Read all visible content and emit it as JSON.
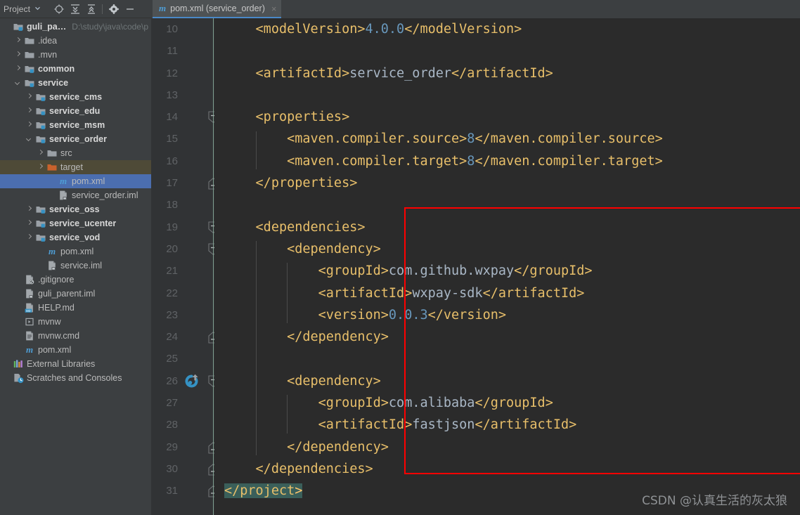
{
  "sidebar": {
    "toolbar": {
      "title": "Project",
      "caret": "▾",
      "icons": [
        {
          "name": "locate-icon",
          "glyph": "⊕"
        },
        {
          "name": "expand-all-icon",
          "glyph": "⤒"
        },
        {
          "name": "collapse-all-icon",
          "glyph": "⤓"
        },
        {
          "name": "settings-gear-icon",
          "glyph": "✸"
        },
        {
          "name": "hide-panel-icon",
          "glyph": "—"
        }
      ]
    },
    "tree": [
      {
        "label": "guli_parent",
        "path": "D:\\study\\java\\code\\p",
        "indent": 0,
        "arrow": "none",
        "icon": "module-folder-icon",
        "bold": true,
        "state": "normal"
      },
      {
        "label": ".idea",
        "path": "",
        "indent": 1,
        "arrow": "right",
        "icon": "folder-icon",
        "bold": false,
        "state": "normal"
      },
      {
        "label": ".mvn",
        "path": "",
        "indent": 1,
        "arrow": "right",
        "icon": "folder-icon",
        "bold": false,
        "state": "normal"
      },
      {
        "label": "common",
        "path": "",
        "indent": 1,
        "arrow": "right",
        "icon": "module-folder-icon",
        "bold": true,
        "state": "normal"
      },
      {
        "label": "service",
        "path": "",
        "indent": 1,
        "arrow": "down",
        "icon": "module-folder-icon",
        "bold": true,
        "state": "normal"
      },
      {
        "label": "service_cms",
        "path": "",
        "indent": 2,
        "arrow": "right",
        "icon": "module-folder-icon",
        "bold": true,
        "state": "normal"
      },
      {
        "label": "service_edu",
        "path": "",
        "indent": 2,
        "arrow": "right",
        "icon": "module-folder-icon",
        "bold": true,
        "state": "normal"
      },
      {
        "label": "service_msm",
        "path": "",
        "indent": 2,
        "arrow": "right",
        "icon": "module-folder-icon",
        "bold": true,
        "state": "normal"
      },
      {
        "label": "service_order",
        "path": "",
        "indent": 2,
        "arrow": "down",
        "icon": "module-folder-icon",
        "bold": true,
        "state": "normal"
      },
      {
        "label": "src",
        "path": "",
        "indent": 3,
        "arrow": "right",
        "icon": "folder-icon",
        "bold": false,
        "state": "normal"
      },
      {
        "label": "target",
        "path": "",
        "indent": 3,
        "arrow": "right",
        "icon": "excluded-folder-icon",
        "bold": false,
        "state": "olive"
      },
      {
        "label": "pom.xml",
        "path": "",
        "indent": 4,
        "arrow": "none",
        "icon": "maven-xml-icon",
        "bold": false,
        "state": "selected"
      },
      {
        "label": "service_order.iml",
        "path": "",
        "indent": 4,
        "arrow": "none",
        "icon": "iml-file-icon",
        "bold": false,
        "state": "normal"
      },
      {
        "label": "service_oss",
        "path": "",
        "indent": 2,
        "arrow": "right",
        "icon": "module-folder-icon",
        "bold": true,
        "state": "normal"
      },
      {
        "label": "service_ucenter",
        "path": "",
        "indent": 2,
        "arrow": "right",
        "icon": "module-folder-icon",
        "bold": true,
        "state": "normal"
      },
      {
        "label": "service_vod",
        "path": "",
        "indent": 2,
        "arrow": "right",
        "icon": "module-folder-icon",
        "bold": true,
        "state": "normal"
      },
      {
        "label": "pom.xml",
        "path": "",
        "indent": 3,
        "arrow": "none",
        "icon": "maven-xml-icon",
        "bold": false,
        "state": "normal"
      },
      {
        "label": "service.iml",
        "path": "",
        "indent": 3,
        "arrow": "none",
        "icon": "iml-file-icon",
        "bold": false,
        "state": "normal"
      },
      {
        "label": ".gitignore",
        "path": "",
        "indent": 1,
        "arrow": "none",
        "icon": "gitignore-file-icon",
        "bold": false,
        "state": "normal"
      },
      {
        "label": "guli_parent.iml",
        "path": "",
        "indent": 1,
        "arrow": "none",
        "icon": "iml-file-icon",
        "bold": false,
        "state": "normal"
      },
      {
        "label": "HELP.md",
        "path": "",
        "indent": 1,
        "arrow": "none",
        "icon": "markdown-file-icon",
        "bold": false,
        "state": "normal"
      },
      {
        "label": "mvnw",
        "path": "",
        "indent": 1,
        "arrow": "none",
        "icon": "script-file-icon",
        "bold": false,
        "state": "normal"
      },
      {
        "label": "mvnw.cmd",
        "path": "",
        "indent": 1,
        "arrow": "none",
        "icon": "cmd-file-icon",
        "bold": false,
        "state": "normal"
      },
      {
        "label": "pom.xml",
        "path": "",
        "indent": 1,
        "arrow": "none",
        "icon": "maven-xml-icon",
        "bold": false,
        "state": "normal"
      },
      {
        "label": "External Libraries",
        "path": "",
        "indent": 0,
        "arrow": "none",
        "icon": "libraries-icon",
        "bold": false,
        "state": "normal"
      },
      {
        "label": "Scratches and Consoles",
        "path": "",
        "indent": 0,
        "arrow": "none",
        "icon": "scratches-icon",
        "bold": false,
        "state": "normal"
      }
    ]
  },
  "editor": {
    "tab": {
      "icon_letter": "m",
      "label": "pom.xml (service_order)",
      "close": "×"
    },
    "first_line_number": 10,
    "lines": [
      {
        "num": 10,
        "indent": 1,
        "fold": "none",
        "maven_icon": false,
        "selected": false,
        "parts": [
          {
            "t": "tag",
            "v": "<modelVersion>"
          },
          {
            "t": "val",
            "v": "4.0.0"
          },
          {
            "t": "tag",
            "v": "</modelVersion>"
          }
        ]
      },
      {
        "num": 11,
        "indent": 1,
        "fold": "none",
        "maven_icon": false,
        "selected": false,
        "parts": []
      },
      {
        "num": 12,
        "indent": 1,
        "fold": "none",
        "maven_icon": false,
        "selected": false,
        "parts": [
          {
            "t": "tag",
            "v": "<artifactId>"
          },
          {
            "t": "txt",
            "v": "service_order"
          },
          {
            "t": "tag",
            "v": "</artifactId>"
          }
        ]
      },
      {
        "num": 13,
        "indent": 1,
        "fold": "none",
        "maven_icon": false,
        "selected": false,
        "parts": []
      },
      {
        "num": 14,
        "indent": 1,
        "fold": "open",
        "maven_icon": false,
        "selected": false,
        "parts": [
          {
            "t": "tag",
            "v": "<properties>"
          }
        ]
      },
      {
        "num": 15,
        "indent": 2,
        "fold": "none",
        "maven_icon": false,
        "selected": false,
        "parts": [
          {
            "t": "tag",
            "v": "<maven.compiler.source>"
          },
          {
            "t": "val",
            "v": "8"
          },
          {
            "t": "tag",
            "v": "</maven.compiler.source>"
          }
        ]
      },
      {
        "num": 16,
        "indent": 2,
        "fold": "none",
        "maven_icon": false,
        "selected": false,
        "parts": [
          {
            "t": "tag",
            "v": "<maven.compiler.target>"
          },
          {
            "t": "val",
            "v": "8"
          },
          {
            "t": "tag",
            "v": "</maven.compiler.target>"
          }
        ]
      },
      {
        "num": 17,
        "indent": 1,
        "fold": "close",
        "maven_icon": false,
        "selected": false,
        "parts": [
          {
            "t": "tag",
            "v": "</properties>"
          }
        ]
      },
      {
        "num": 18,
        "indent": 1,
        "fold": "none",
        "maven_icon": false,
        "selected": false,
        "parts": []
      },
      {
        "num": 19,
        "indent": 1,
        "fold": "open",
        "maven_icon": false,
        "selected": false,
        "parts": [
          {
            "t": "tag",
            "v": "<dependencies>"
          }
        ]
      },
      {
        "num": 20,
        "indent": 2,
        "fold": "open",
        "maven_icon": false,
        "selected": false,
        "parts": [
          {
            "t": "tag",
            "v": "<dependency>"
          }
        ]
      },
      {
        "num": 21,
        "indent": 3,
        "fold": "none",
        "maven_icon": false,
        "selected": false,
        "parts": [
          {
            "t": "tag",
            "v": "<groupId>"
          },
          {
            "t": "txt",
            "v": "com.github.wxpay"
          },
          {
            "t": "tag",
            "v": "</groupId>"
          }
        ]
      },
      {
        "num": 22,
        "indent": 3,
        "fold": "none",
        "maven_icon": false,
        "selected": false,
        "parts": [
          {
            "t": "tag",
            "v": "<artifactId>"
          },
          {
            "t": "txt",
            "v": "wxpay-sdk"
          },
          {
            "t": "tag",
            "v": "</artifactId>"
          }
        ]
      },
      {
        "num": 23,
        "indent": 3,
        "fold": "none",
        "maven_icon": false,
        "selected": false,
        "parts": [
          {
            "t": "tag",
            "v": "<version>"
          },
          {
            "t": "val",
            "v": "0.0.3"
          },
          {
            "t": "tag",
            "v": "</version>"
          }
        ]
      },
      {
        "num": 24,
        "indent": 2,
        "fold": "close",
        "maven_icon": false,
        "selected": false,
        "parts": [
          {
            "t": "tag",
            "v": "</dependency>"
          }
        ]
      },
      {
        "num": 25,
        "indent": 1,
        "fold": "none",
        "maven_icon": false,
        "selected": false,
        "parts": []
      },
      {
        "num": 26,
        "indent": 2,
        "fold": "open",
        "maven_icon": true,
        "selected": false,
        "parts": [
          {
            "t": "tag",
            "v": "<dependency>"
          }
        ]
      },
      {
        "num": 27,
        "indent": 3,
        "fold": "none",
        "maven_icon": false,
        "selected": false,
        "parts": [
          {
            "t": "tag",
            "v": "<groupId>"
          },
          {
            "t": "txt",
            "v": "com.alibaba"
          },
          {
            "t": "tag",
            "v": "</groupId>"
          }
        ]
      },
      {
        "num": 28,
        "indent": 3,
        "fold": "none",
        "maven_icon": false,
        "selected": false,
        "parts": [
          {
            "t": "tag",
            "v": "<artifactId>"
          },
          {
            "t": "txt",
            "v": "fastjson"
          },
          {
            "t": "tag",
            "v": "</artifactId>"
          }
        ]
      },
      {
        "num": 29,
        "indent": 2,
        "fold": "close",
        "maven_icon": false,
        "selected": false,
        "parts": [
          {
            "t": "tag",
            "v": "</dependency>"
          }
        ]
      },
      {
        "num": 30,
        "indent": 1,
        "fold": "close",
        "maven_icon": false,
        "selected": false,
        "parts": [
          {
            "t": "tag",
            "v": "</dependencies>"
          }
        ]
      },
      {
        "num": 31,
        "indent": 0,
        "fold": "close",
        "maven_icon": false,
        "selected": true,
        "parts": [
          {
            "t": "tag sel",
            "v": "</project"
          },
          {
            "t": "brace-hl sel",
            "v": ">"
          }
        ]
      }
    ]
  },
  "annotation": {
    "name": "red-highlight-rectangle",
    "color": "#ff0000"
  },
  "watermark": {
    "text": "CSDN @认真生活的灰太狼"
  },
  "colors": {
    "sidebar_bg": "#3c3f41",
    "editor_bg": "#2b2b2b",
    "gutter_bg": "#313335",
    "selection_blue": "#4b6eaf",
    "excluded_olive": "#4e4a37",
    "tag_color": "#e8bf6a",
    "text_color": "#a9b7c6",
    "value_color": "#6897bb",
    "brace_match": "#ffc66d",
    "code_selection": "#3a5f5a",
    "tab_underline": "#4a88c7"
  }
}
